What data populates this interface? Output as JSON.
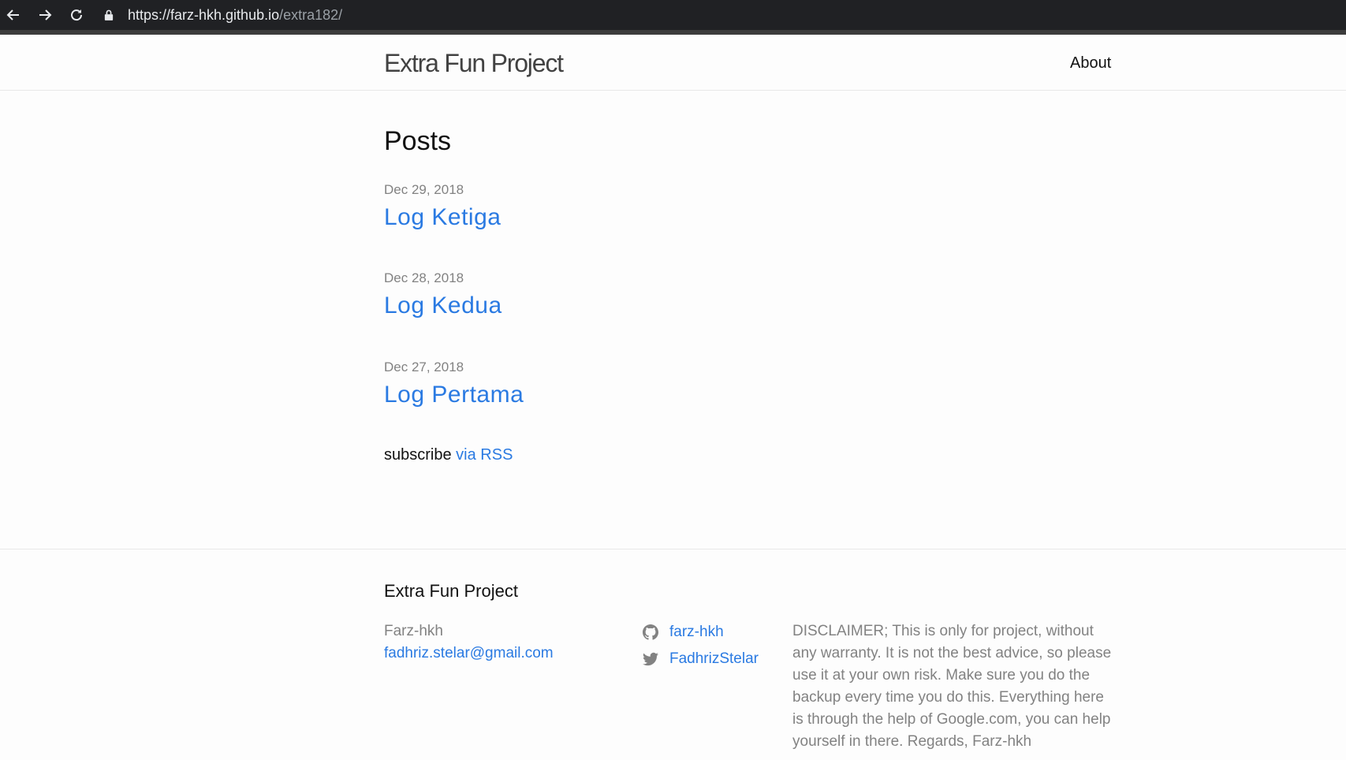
{
  "browser": {
    "url_host": "https://farz-hkh.github.io",
    "url_path": "/extra182/"
  },
  "header": {
    "site_title": "Extra Fun Project",
    "nav": {
      "about": "About"
    }
  },
  "main": {
    "heading": "Posts",
    "posts": [
      {
        "date": "Dec 29, 2018",
        "title": "Log Ketiga"
      },
      {
        "date": "Dec 28, 2018",
        "title": "Log Kedua"
      },
      {
        "date": "Dec 27, 2018",
        "title": "Log Pertama"
      }
    ],
    "subscribe_text": "subscribe",
    "rss_link": "via RSS"
  },
  "footer": {
    "heading": "Extra Fun Project",
    "author": "Farz-hkh",
    "email": "fadhriz.stelar@gmail.com",
    "github": "farz-hkh",
    "twitter": "FadhrizStelar",
    "disclaimer": "DISCLAIMER; This is only for project, without any warranty. It is not the best advice, so please use it at your own risk. Make sure you do the backup every time you do this. Everything here is through the help of Google.com, you can help yourself in there. Regards, Farz-hkh"
  },
  "colors": {
    "link": "#2a7ae2",
    "meta": "#828282",
    "chrome": "#202124"
  },
  "icons": [
    "back-arrow-icon",
    "forward-arrow-icon",
    "reload-icon",
    "lock-icon",
    "github-icon",
    "twitter-icon"
  ]
}
